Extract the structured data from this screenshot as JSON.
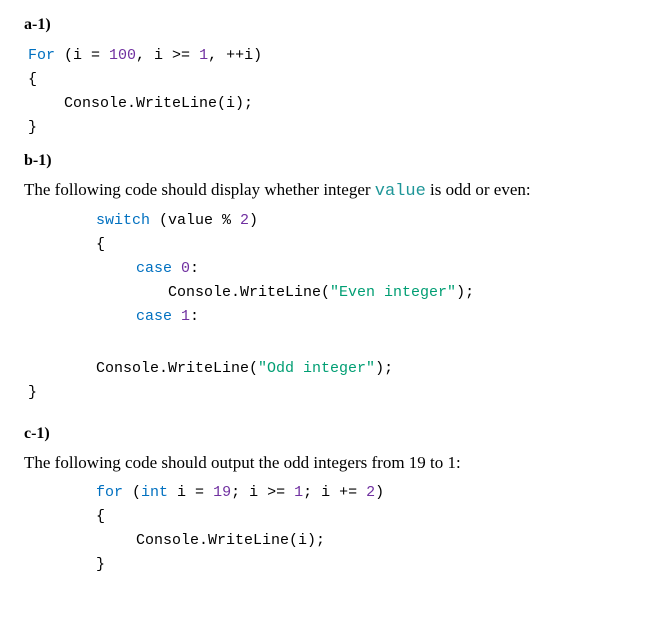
{
  "section_a": {
    "label": "a-1)",
    "code": {
      "l1_kw": "For",
      "l1_rest": " (i = ",
      "l1_num": "100",
      "l1_tail": ", i >= ",
      "l1_num2": "1",
      "l1_end": ", ++i)",
      "l2": "{",
      "l3": "Console.WriteLine(i);",
      "l4": "}"
    }
  },
  "section_b": {
    "label": "b-1)",
    "desc_pre": "The following code should display whether integer ",
    "desc_var": "value",
    "desc_post": " is odd or even:",
    "code": {
      "l1_kw": "switch",
      "l1_rest": " (value % ",
      "l1_num": "2",
      "l1_end": ")",
      "l2": "{",
      "l3_kw": "case",
      "l3_rest": " ",
      "l3_num": "0",
      "l3_end": ":",
      "l4_pre": "Console.WriteLine(",
      "l4_str": "\"Even integer\"",
      "l4_end": ");",
      "l5_kw": "case",
      "l5_rest": " ",
      "l5_num": "1",
      "l5_end": ":",
      "l6_pre": "Console.WriteLine(",
      "l6_str": "\"Odd integer\"",
      "l6_end": ");",
      "l7": "}"
    }
  },
  "section_c": {
    "label": "c-1)",
    "desc": "The following code should output the odd integers from 19 to 1:",
    "code": {
      "l1_kw1": "for",
      "l1_mid1": " (",
      "l1_kw2": "int",
      "l1_mid2": " i = ",
      "l1_num1": "19",
      "l1_mid3": "; i >= ",
      "l1_num2": "1",
      "l1_mid4": "; i += ",
      "l1_num3": "2",
      "l1_end": ")",
      "l2": "{",
      "l3": "Console.WriteLine(i);",
      "l4": "}"
    }
  }
}
